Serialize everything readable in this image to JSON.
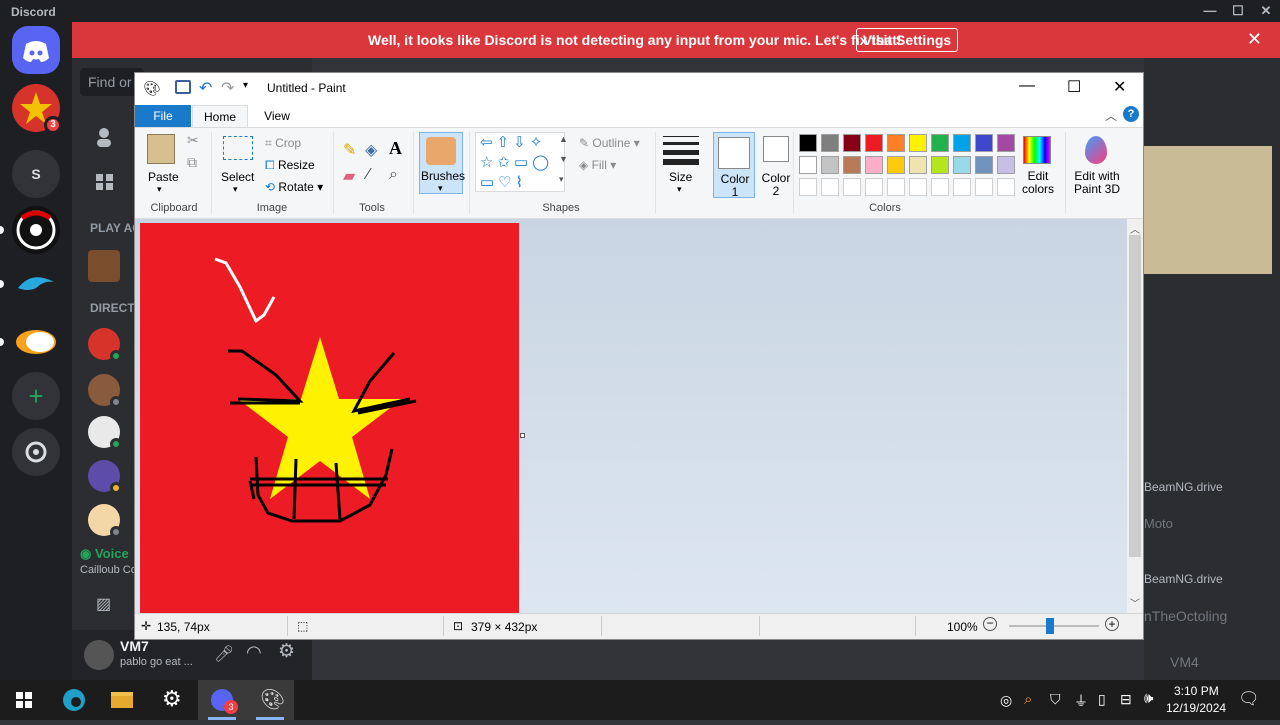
{
  "discord": {
    "title": "Discord",
    "banner": {
      "message": "Well, it looks like Discord is not detecting any input from your mic. Let's fix that!",
      "button": "Visit Settings"
    },
    "search_placeholder": "Find or",
    "guild_badge": "3",
    "guild_letter": "S",
    "sections": {
      "play": "PLAY AC",
      "direct": "DIRECT"
    },
    "voice": {
      "label": "Voice",
      "channel": "Cailloub Co"
    },
    "user": {
      "name": "VM7",
      "status": "pablo go eat ..."
    },
    "right": {
      "items": [
        "BeamNG.drive",
        "Moto",
        "BeamNG.drive",
        "nTheOctoling",
        "VM4"
      ]
    }
  },
  "paint": {
    "window_title": "Untitled - Paint",
    "tabs": [
      "File",
      "Home",
      "View"
    ],
    "groups": {
      "clipboard": "Clipboard",
      "image": "Image",
      "tools": "Tools",
      "shapes": "Shapes",
      "colors": "Colors"
    },
    "buttons": {
      "paste": "Paste",
      "select": "Select",
      "crop": "Crop",
      "resize": "Resize",
      "rotate": "Rotate",
      "brushes": "Brushes",
      "outline": "Outline",
      "fill": "Fill",
      "size": "Size",
      "color1": "Color 1",
      "color2": "Color 2",
      "edit_colors": "Edit colors",
      "paint3d": "Edit with Paint 3D"
    },
    "palette": [
      "#000000",
      "#7f7f7f",
      "#880015",
      "#ed1c24",
      "#ff7f27",
      "#fff200",
      "#22b14c",
      "#00a2e8",
      "#3f48cc",
      "#a349a4",
      "#ffffff",
      "#c3c3c3",
      "#b97a57",
      "#ffaec9",
      "#ffc90e",
      "#efe4b0",
      "#b5e61d",
      "#99d9ea",
      "#7092be",
      "#c8bfe7"
    ],
    "canvas_bg": "#ed1c24",
    "status": {
      "cursor": "135, 74px",
      "size": "379 × 432px",
      "zoom": "100%"
    }
  },
  "taskbar": {
    "time": "3:10 PM",
    "date": "12/19/2024",
    "badge": "3"
  }
}
